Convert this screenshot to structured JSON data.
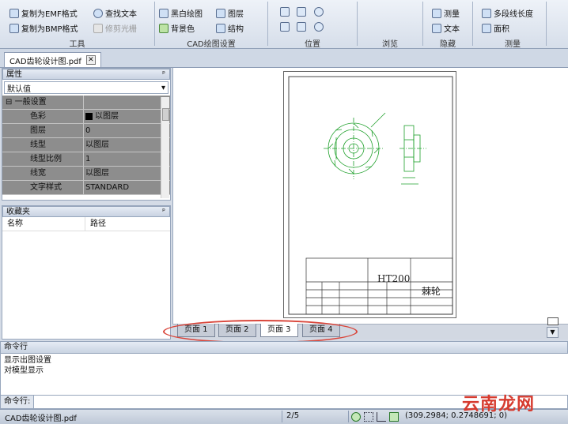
{
  "ribbon": {
    "tools": {
      "emf": "复制为EMF格式",
      "bmp": "复制为BMP格式",
      "find": "查找文本",
      "trim": "修剪光栅",
      "group": "工具"
    },
    "drawing": {
      "bw": "黑白绘图",
      "layer": "图层",
      "bg": "背景色",
      "struct": "结构",
      "group": "CAD绘图设置"
    },
    "position": {
      "group": "位置"
    },
    "browse": {
      "group": "浏览"
    },
    "hide": {
      "measure": "测量",
      "text": "文本",
      "group": "隐藏"
    },
    "measure": {
      "polyline": "多段线长度",
      "area": "面积",
      "group": "测量"
    }
  },
  "doc_tab": {
    "label": "CAD齿轮设计图.pdf",
    "close": "✕"
  },
  "properties": {
    "title": "属性",
    "pin": "ᵖ",
    "selected": "默认值",
    "category": "一般设置",
    "expander": "⊟",
    "rows": [
      {
        "key": "色彩",
        "value": "以图层"
      },
      {
        "key": "图层",
        "value": "0"
      },
      {
        "key": "线型",
        "value": "以图层"
      },
      {
        "key": "线型比例",
        "value": "1"
      },
      {
        "key": "线宽",
        "value": "以图层"
      },
      {
        "key": "文字样式",
        "value": "STANDARD"
      }
    ]
  },
  "favorites": {
    "title": "收藏夹",
    "pin": "ᵖ",
    "col_name": "名称",
    "col_path": "路径"
  },
  "drawing": {
    "material": "HT200",
    "part_name": "棘轮"
  },
  "pages": [
    "页面 1",
    "页面 2",
    "页面 3",
    "页面 4"
  ],
  "active_page": 2,
  "command": {
    "title": "命令行",
    "lines": [
      "显示出图设置",
      "对模型显示"
    ],
    "input_label": "命令行:",
    "input_value": ""
  },
  "status": {
    "file": "CAD齿轮设计图.pdf",
    "page": "2/5",
    "coords": "(309.2984; 0.2748691; 0)"
  },
  "watermark": "云南龙网",
  "colors": {
    "annotation": "#d9463b",
    "drawing_green": "#1fa02b",
    "watermark": "#d63b2f"
  }
}
